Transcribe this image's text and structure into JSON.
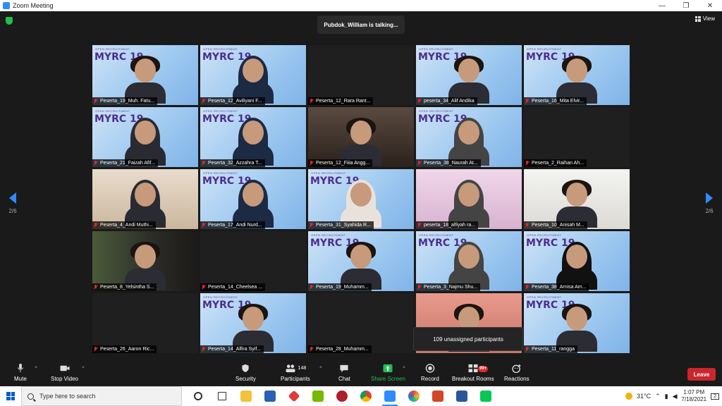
{
  "window": {
    "title": "Zoom Meeting",
    "controls": [
      "—",
      "❐",
      "✕"
    ]
  },
  "meeting": {
    "talking_indicator": "Pubdok_William is talking...",
    "view_label": "View",
    "page_left": "2/6",
    "page_right": "2/6",
    "unassigned": "109 unassigned participants"
  },
  "participants": [
    "Peserta_19_Muh. Fatu...",
    "Peserta_12_Aviliyani F...",
    "Peserta_12_Rara Rant...",
    "peserta_34_Alif Andika",
    "Peserta_16_Mita Elvir...",
    "Peserta_21_Faizah Afif...",
    "Peserta_32_Azzahra T...",
    "Peserta_12_Fiiia Angg...",
    "Peserta_38_Naurah At...",
    "Peserta_2_Raihan Ah...",
    "Peserta_4_Andi Muthi...",
    "Peserta_17_Andi Nurd...",
    "Peserta_31_Syahida R...",
    "peserta_18_alfiyah ra...",
    "Peserta_10_Anisah M...",
    "Peserta_8_Yelsintha S...",
    "Peserta_14_Cheelsea ...",
    "Peserta_19_Muhamm...",
    "Peserta_3_Najmu Shu...",
    "Peserta_38_Arnisa Am...",
    "Peserta_26_Aaron Ric...",
    "Peserta_14_Alfira Syif...",
    "Peserta_28_Muhamm...",
    "",
    "Peserta_11_rangga"
  ],
  "toolbar": {
    "mute": "Mute",
    "stop_video": "Stop Video",
    "security": "Security",
    "participants": "Participants",
    "participants_count": "148",
    "chat": "Chat",
    "share_screen": "Share Screen",
    "record": "Record",
    "breakout_rooms": "Breakout Rooms",
    "breakout_badge": "99+",
    "reactions": "Reactions",
    "leave": "Leave"
  },
  "taskbar": {
    "search_placeholder": "Type here to search",
    "weather": "31°C",
    "time": "1:07 PM",
    "date": "7/18/2021",
    "notifications": "2"
  },
  "colors": {
    "accent": "#2d8cff",
    "leave": "#c9262e",
    "share": "#1fbf4f",
    "mic_off": "#e02828"
  }
}
